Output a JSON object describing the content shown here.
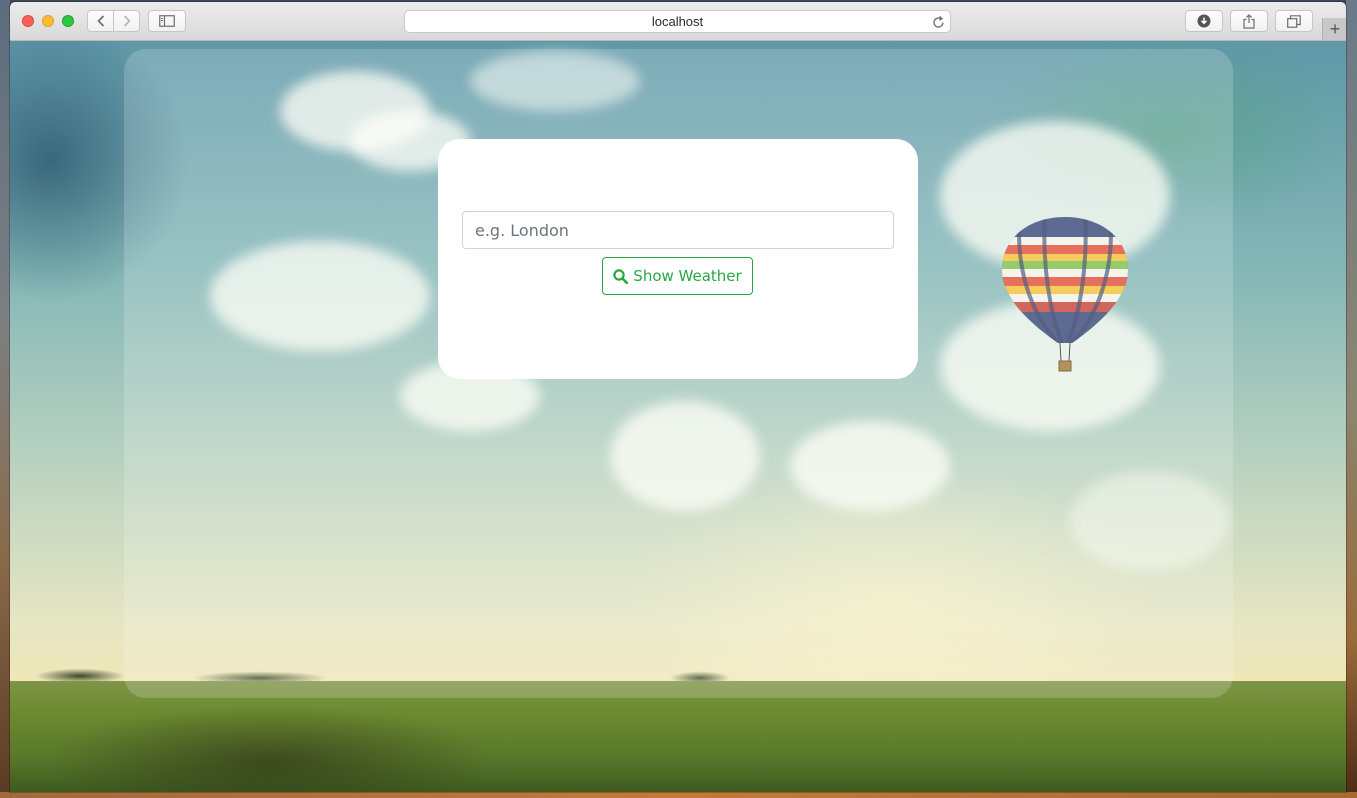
{
  "browser": {
    "url": "localhost",
    "icons": {
      "back": "chevron-left-icon",
      "forward": "chevron-right-icon",
      "sidebar": "sidebar-icon",
      "reload": "reload-icon",
      "downloads": "download-icon",
      "share": "share-icon",
      "tabs": "tabs-icon",
      "new_tab": "plus-icon"
    }
  },
  "weather_form": {
    "city_placeholder": "e.g. London",
    "city_value": "",
    "submit_label": "Show Weather",
    "submit_icon": "search-icon"
  },
  "colors": {
    "accent": "#28a745",
    "card_background": "#ffffff"
  }
}
